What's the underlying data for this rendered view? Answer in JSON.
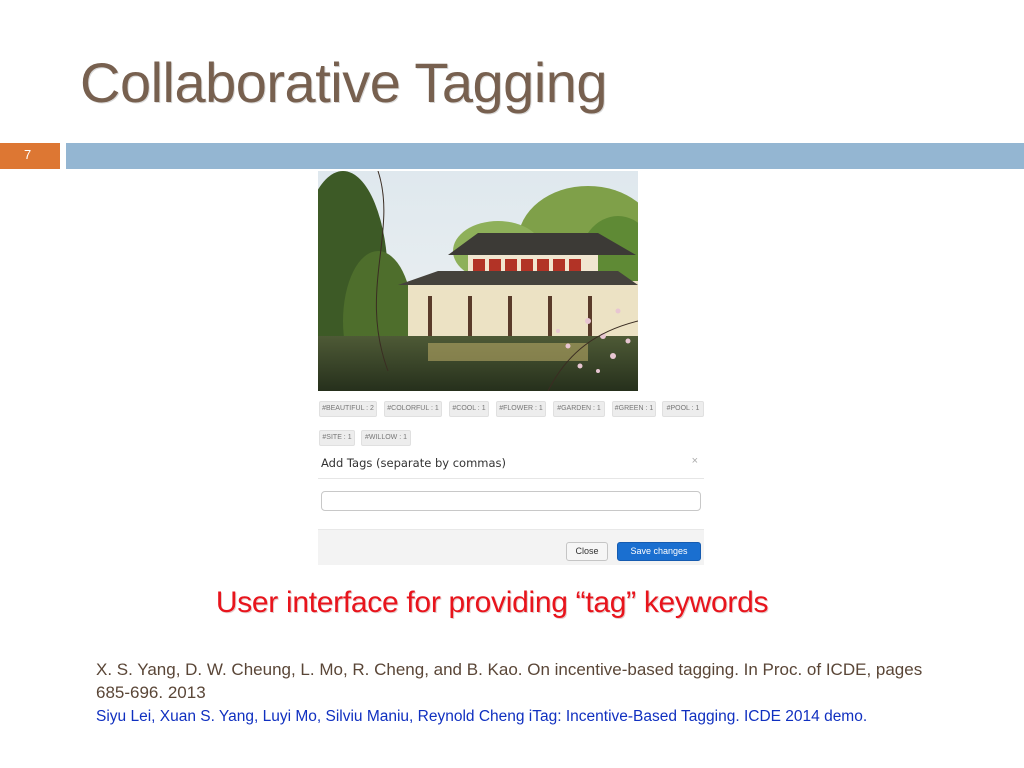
{
  "slide": {
    "title": "Collaborative Tagging",
    "number": "7",
    "caption": "User interface for providing “tag” keywords"
  },
  "tagging_ui": {
    "tags": [
      "#BEAUTIFUL : 2",
      "#COLORFUL : 1",
      "#COOL : 1",
      "#FLOWER : 1",
      "#GARDEN : 1",
      "#GREEN : 1",
      "#POOL : 1",
      "#SITE : 1",
      "#WILLOW : 1"
    ],
    "modal_title": "Add Tags (separate by commas)",
    "close_glyph": "×",
    "input_value": "",
    "close_button": "Close",
    "save_button": "Save changes"
  },
  "references": {
    "ref1": "X. S. Yang, D. W. Cheung, L. Mo, R. Cheng, and B. Kao. On incentive-based tagging. In Proc. of ICDE, pages 685-696. 2013",
    "ref2": "Siyu Lei, Xuan S. Yang, Luyi Mo, Silviu Maniu, Reynold Cheng  iTag: Incentive-Based Tagging. ICDE 2014 demo."
  },
  "colors": {
    "title": "#77604f",
    "number_box": "#dd7733",
    "title_bar": "#94b6d2",
    "caption": "#e8141c",
    "ref1": "#5a4637",
    "ref2": "#1030c0",
    "save_button": "#1a6fd0"
  }
}
